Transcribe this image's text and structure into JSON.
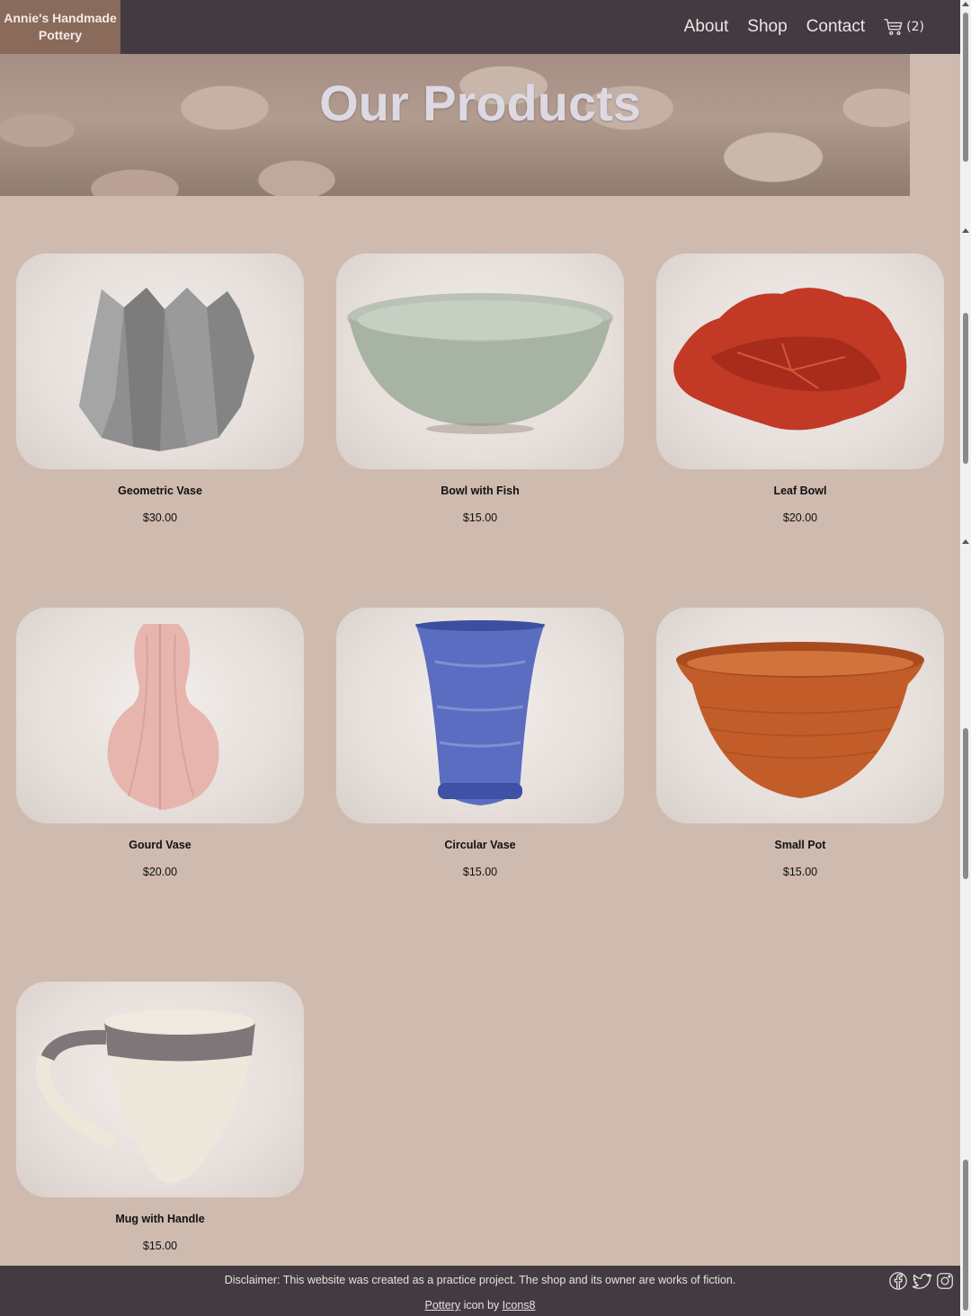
{
  "brand": {
    "name": "Annie's Handmade Pottery"
  },
  "nav": {
    "items": [
      {
        "label": "About"
      },
      {
        "label": "Shop"
      },
      {
        "label": "Contact"
      }
    ],
    "cart_count": "(2)"
  },
  "hero": {
    "title": "Our Products"
  },
  "products": [
    {
      "name": "Geometric Vase",
      "price": "$30.00"
    },
    {
      "name": "Bowl with Fish",
      "price": "$15.00"
    },
    {
      "name": "Leaf Bowl",
      "price": "$20.00"
    },
    {
      "name": "Gourd Vase",
      "price": "$20.00"
    },
    {
      "name": "Circular Vase",
      "price": "$15.00"
    },
    {
      "name": "Small Pot",
      "price": "$15.00"
    },
    {
      "name": "Mug with Handle",
      "price": "$15.00"
    }
  ],
  "footer": {
    "disclaimer": "Disclaimer: This website was created as a practice project. The shop and its owner are works of fiction.",
    "credit_link1": "Pottery",
    "credit_middle": " icon by ",
    "credit_link2": "Icons8"
  },
  "icons": [
    "cart-icon",
    "facebook-icon",
    "twitter-icon",
    "instagram-icon"
  ],
  "colors": {
    "nav_bg": "#433a42",
    "brand_bg": "#8a6a5a",
    "page_bg": "#cfbab0"
  }
}
